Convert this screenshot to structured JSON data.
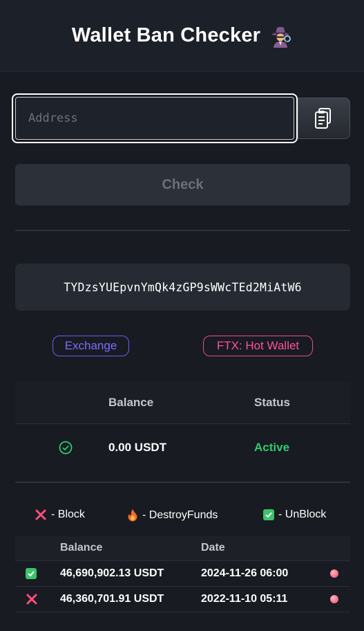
{
  "header": {
    "title": "Wallet Ban Checker",
    "icon": "spy-icon"
  },
  "form": {
    "address_placeholder": "Address",
    "address_value": "",
    "check_label": "Check",
    "paste_icon": "clipboard-icon"
  },
  "result": {
    "address": "TYDzsYUEpvnYmQk4zGP9sWWcTEd2MiAtW6",
    "tags": [
      {
        "label": "Exchange",
        "color": "#7c6cff"
      },
      {
        "label": "FTX: Hot Wallet",
        "color": "#ff4fa1"
      }
    ],
    "status_table": {
      "headers": {
        "balance": "Balance",
        "status": "Status"
      },
      "row": {
        "balance": "0.00 USDT",
        "status": "Active",
        "status_color": "#2ecc71"
      }
    }
  },
  "legend": [
    {
      "icon": "x-icon",
      "label": "- Block"
    },
    {
      "icon": "fire-icon",
      "label": "- DestroyFunds"
    },
    {
      "icon": "check-box-icon",
      "label": "- UnBlock"
    }
  ],
  "history": {
    "headers": {
      "balance": "Balance",
      "date": "Date"
    },
    "rows": [
      {
        "type": "unblock",
        "balance": "46,690,902.13 USDT",
        "date": "2024-11-26 06:00"
      },
      {
        "type": "block",
        "balance": "46,360,701.91 USDT",
        "date": "2022-11-10 05:11"
      }
    ]
  }
}
